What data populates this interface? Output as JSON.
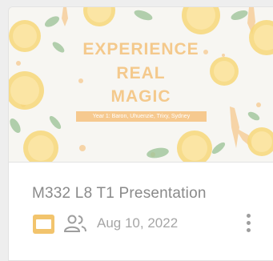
{
  "file": {
    "title": "M332 L8 T1 Presentation",
    "modified_date": "Aug 10, 2022",
    "type_icon": "slides-icon",
    "sharing_icon": "shared-people-icon",
    "menu_icon": "more-vert-icon"
  },
  "thumbnail": {
    "title_line1": "EXPERIENCE",
    "title_line2": "REAL",
    "title_line3": "MAGIC",
    "subtitle": "Year 1: Baron, Uhuenzie, Trixy, Sydney"
  },
  "colors": {
    "accent": "#f4c98c",
    "slides_icon": "#f2c46d",
    "lemon": "#f7d779",
    "leaf": "#9fc59a",
    "text_title": "#8a8a8a",
    "text_meta": "#a6a6a6"
  }
}
